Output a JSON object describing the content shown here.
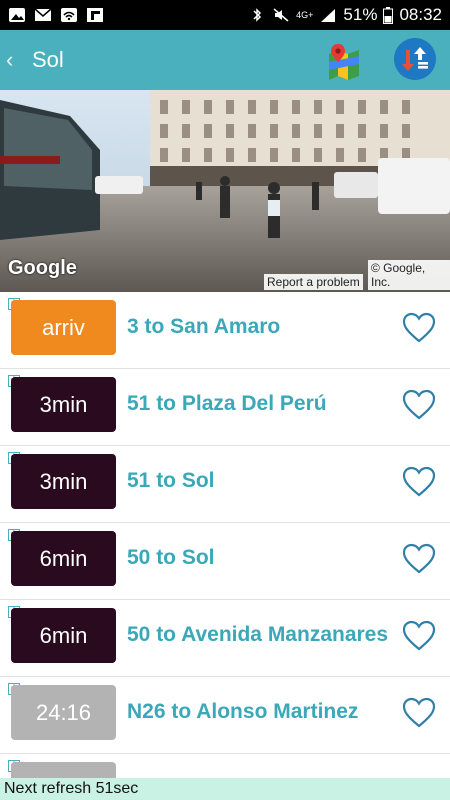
{
  "status_bar": {
    "battery": "51%",
    "time": "08:32",
    "network": "4G+"
  },
  "app_bar": {
    "back_symbol": "‹",
    "title": "Sol"
  },
  "street_view": {
    "brand": "Google",
    "report_link": "Report a problem",
    "copyright": "© Google, Inc."
  },
  "arrivals": [
    {
      "eta": "arriv",
      "route": "3 to San Amaro",
      "color": "#f08a1e"
    },
    {
      "eta": "3min",
      "route": "51 to Plaza Del Perú",
      "color": "#2a0a1f"
    },
    {
      "eta": "3min",
      "route": "51 to Sol",
      "color": "#2a0a1f"
    },
    {
      "eta": "6min",
      "route": "50 to Sol",
      "color": "#2a0a1f"
    },
    {
      "eta": "6min",
      "route": "50 to Avenida Manzanares",
      "color": "#2a0a1f"
    },
    {
      "eta": "24:16",
      "route": "N26 to Alonso Martinez",
      "color": "#b3b3b3"
    },
    {
      "eta": "",
      "route": "",
      "color": "#b3b3b3"
    }
  ],
  "footer": {
    "refresh_text": "Next refresh 51sec"
  },
  "colors": {
    "accent": "#4ab0be",
    "footer_bg": "#c9f2e4"
  }
}
